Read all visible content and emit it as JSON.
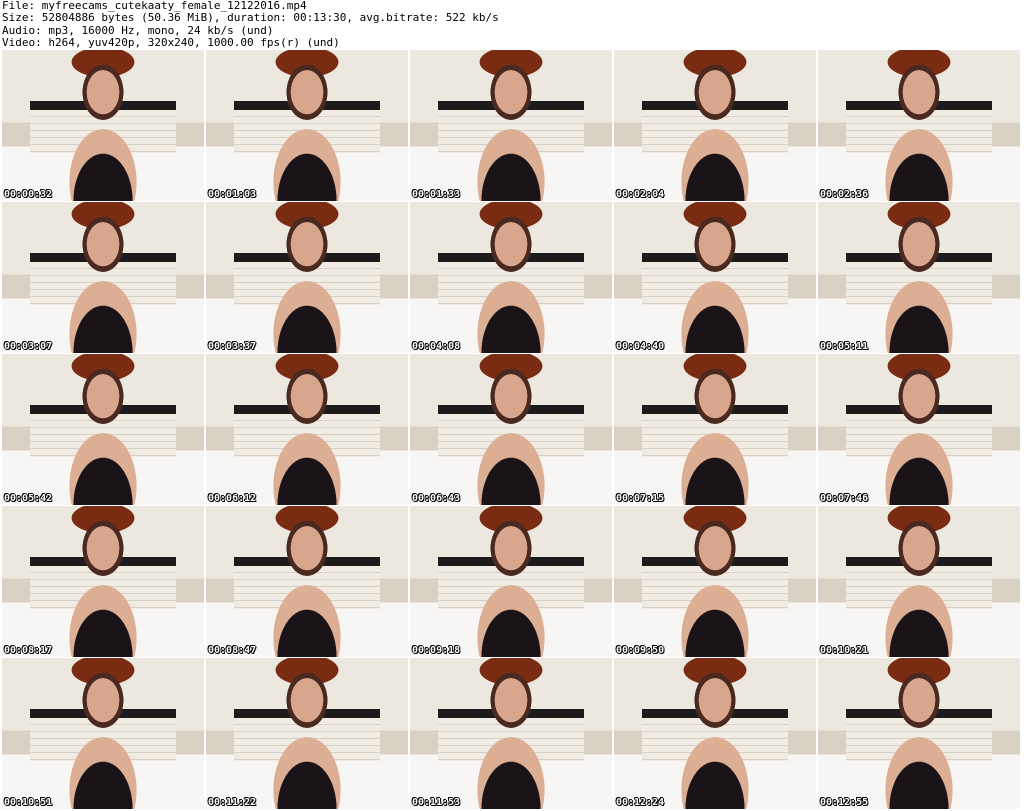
{
  "header": {
    "file": "File: myfreecams_cutekaaty_female_12122016.mp4",
    "size": "Size: 52804886 bytes (50.36 MiB), duration: 00:13:30, avg.bitrate: 522 kb/s",
    "audio": "Audio: mp3, 16000 Hz, mono, 24 kb/s (und)",
    "video": "Video: h264, yuv420p, 320x240, 1000.00 fps(r) (und)"
  },
  "thumbnails": [
    {
      "timestamp": "00:00:32"
    },
    {
      "timestamp": "00:01:03"
    },
    {
      "timestamp": "00:01:33"
    },
    {
      "timestamp": "00:02:04"
    },
    {
      "timestamp": "00:02:36"
    },
    {
      "timestamp": "00:03:07"
    },
    {
      "timestamp": "00:03:37"
    },
    {
      "timestamp": "00:04:08"
    },
    {
      "timestamp": "00:04:40"
    },
    {
      "timestamp": "00:05:11"
    },
    {
      "timestamp": "00:05:42"
    },
    {
      "timestamp": "00:06:12"
    },
    {
      "timestamp": "00:06:43"
    },
    {
      "timestamp": "00:07:15"
    },
    {
      "timestamp": "00:07:46"
    },
    {
      "timestamp": "00:08:17"
    },
    {
      "timestamp": "00:08:47"
    },
    {
      "timestamp": "00:09:18"
    },
    {
      "timestamp": "00:09:50"
    },
    {
      "timestamp": "00:10:21"
    },
    {
      "timestamp": "00:10:51"
    },
    {
      "timestamp": "00:11:22"
    },
    {
      "timestamp": "00:11:53"
    },
    {
      "timestamp": "00:12:24"
    },
    {
      "timestamp": "00:12:55"
    }
  ]
}
